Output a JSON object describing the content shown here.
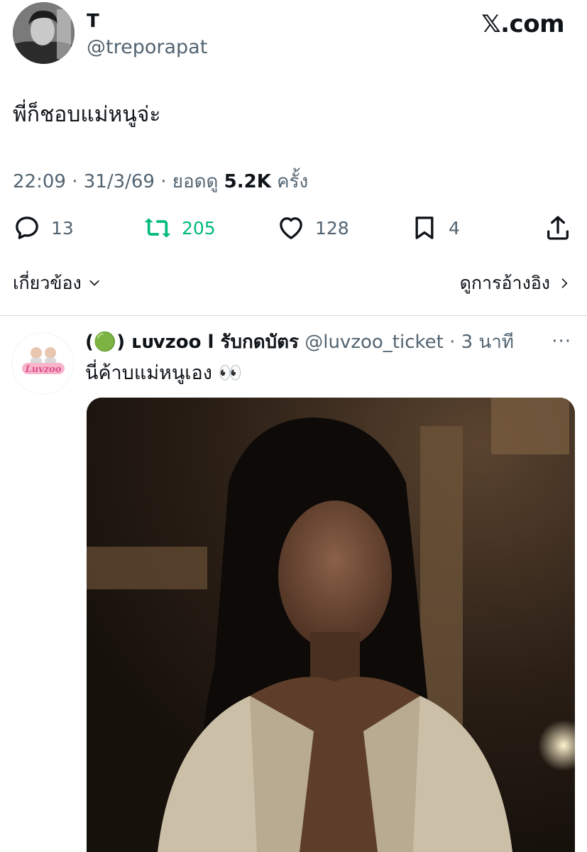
{
  "header": {
    "display_name": "T",
    "handle": "@treporapat",
    "brand": "𝕏.com"
  },
  "tweet": {
    "text": "พี่ก็ชอบแม่หนูจ่ะ",
    "time": "22:09",
    "date": "31/3/69",
    "views_label": "ยอดดู",
    "views": "5.2K",
    "views_suffix": "ครั้ง"
  },
  "actions": {
    "replies": "13",
    "reposts": "205",
    "likes": "128",
    "bookmarks": "4"
  },
  "related": {
    "label": "เกี่ยวข้อง",
    "quotes_label": "ดูการอ้างอิง"
  },
  "reply": {
    "name": "(🟢) ʟᴜᴠᴢᴏᴏ l รับกดบัตร",
    "handle": "@luvzoo_ticket",
    "time": "3 นาที",
    "text": "นี่ค้าบแม่หนูเอง 👀",
    "avatar_logo_text": "Luvzoo"
  },
  "colors": {
    "accent_green": "#00ba7c",
    "secondary_text": "#536471",
    "primary_text": "#0f1419",
    "divider": "#cfd9de"
  }
}
